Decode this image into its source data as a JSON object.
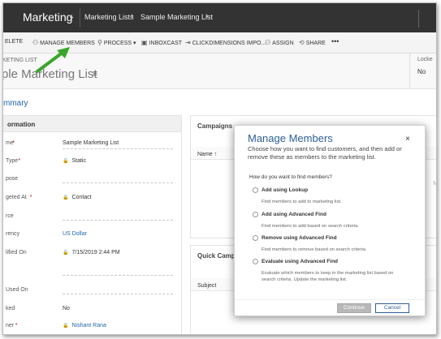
{
  "navbar": {
    "app_name": "Marketing",
    "app_chevron": "⌄",
    "breadcrumb_1": "Marketing Lists",
    "breadcrumb_sep": "›",
    "breadcrumb_2": "Sample Marketing List"
  },
  "commands": [
    {
      "label": "ELETE",
      "icon": "delete-icon",
      "glyph": ""
    },
    {
      "label": "MANAGE MEMBERS",
      "icon": "manage-members-icon",
      "glyph": "⚇"
    },
    {
      "label": "PROCESS",
      "icon": "process-icon",
      "glyph": "⚲"
    },
    {
      "label": "INBOXCAST",
      "icon": "inboxcast-icon",
      "glyph": "▣"
    },
    {
      "label": "CLICKDIMENSIONS IMPO...",
      "icon": "import-icon",
      "glyph": "⇥"
    },
    {
      "label": "ASSIGN",
      "icon": "assign-icon",
      "glyph": "⚇"
    },
    {
      "label": "SHARE",
      "icon": "share-icon",
      "glyph": "⟲"
    },
    {
      "label": "•••",
      "icon": "more-icon",
      "glyph": ""
    }
  ],
  "process_caret": "▾",
  "header": {
    "entity_type": "KETING LIST",
    "record_title": "ple Marketing List",
    "title_icon_glyph": "≡",
    "owner_label": "Locke",
    "owner_value": "No"
  },
  "tabs": {
    "summary": "mmary"
  },
  "info_section": {
    "title": "ormation",
    "fields": [
      {
        "label": "me",
        "required": "*",
        "value": "Sample Marketing List",
        "locked": false,
        "link": false,
        "line": true
      },
      {
        "label": "Type",
        "required": "*",
        "value": "Static",
        "locked": true,
        "link": false,
        "line": false
      },
      {
        "label": "pose",
        "required": "",
        "value": "",
        "locked": false,
        "link": false,
        "line": true
      },
      {
        "label": "geted At",
        "required": "*",
        "value": "Contact",
        "locked": true,
        "link": false,
        "line": false
      },
      {
        "label": "rce",
        "required": "",
        "value": "",
        "locked": false,
        "link": false,
        "line": true
      },
      {
        "label": "rency",
        "required": "",
        "value": "US Dollar",
        "locked": false,
        "link": true,
        "line": false
      },
      {
        "label": "lified On",
        "required": "",
        "value": "7/15/2019  2:44 PM",
        "locked": true,
        "link": false,
        "line": false
      },
      {
        "label": "",
        "required": "",
        "value": "",
        "locked": false,
        "link": false,
        "line": true
      },
      {
        "label": "Used On",
        "required": "",
        "value": "",
        "locked": false,
        "link": false,
        "line": true
      },
      {
        "label": "ked",
        "required": "",
        "value": "No",
        "locked": false,
        "link": false,
        "line": false
      },
      {
        "label": "ner",
        "required": "*",
        "value": "Nishant Rana",
        "locked": true,
        "link": true,
        "line": false
      }
    ],
    "lock_glyph": "🔒"
  },
  "campaigns_section": {
    "title": "Campaigns",
    "column_name": "Name ↑",
    "edge_text": "Ma"
  },
  "quick_campaigns_section": {
    "title": "Quick Campai",
    "column_subject": "Subject"
  },
  "modal": {
    "title": "Manage Members",
    "close_glyph": "×",
    "description": "Choose how you want to find customers, and then add or remove these as members to the marketing list.",
    "question": "How do you want to find members?",
    "options": [
      {
        "label": "Add using Lookup",
        "description": "Find members to add to marketing list."
      },
      {
        "label": "Add using Advanced Find",
        "description": "Find members to add based on search criteria."
      },
      {
        "label": "Remove using Advanced Find",
        "description": "Find members to remove based on search criteria."
      },
      {
        "label": "Evaluate using Advanced Find",
        "description": "Evaluate which members to keep in the marketing list based on search criteria. Update the marketing list."
      }
    ],
    "continue_label": "Continue",
    "cancel_label": "Cancel"
  },
  "colors": {
    "navbar_bg": "#333333",
    "accent_blue": "#2d5f9a",
    "link_blue": "#2266aa",
    "annotation_green": "#3aa62a"
  }
}
